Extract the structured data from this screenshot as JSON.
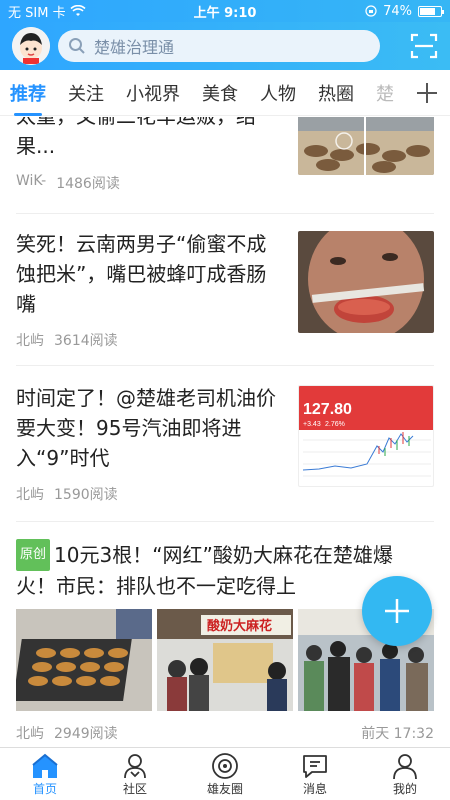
{
  "statusbar": {
    "carrier": "无 SIM 卡",
    "time": "上午 9:10",
    "battery": "74%",
    "battery_level": 0.74
  },
  "header": {
    "search_placeholder": "楚雄治理通"
  },
  "tabs": [
    "推荐",
    "关注",
    "小视界",
    "美食",
    "人物",
    "热圈",
    "楚"
  ],
  "articles": [
    {
      "title": "太重，又偷二花车运贩，结果...",
      "author": "WiK-",
      "reads": "1486阅读"
    },
    {
      "title": "笑死！云南两男子“偷蜜不成蚀把米”，嘴巴被蜂叮成香肠嘴",
      "author": "北屿",
      "reads": "3614阅读"
    },
    {
      "title": "时间定了！@楚雄老司机油价要大变！95号汽油即将进入“9”时代",
      "author": "北屿",
      "reads": "1590阅读",
      "chart_price": "127.80",
      "chart_change": "+3.43",
      "chart_pct": "2.76%"
    },
    {
      "tag": "原创",
      "title": "10元3根！“网红”酸奶大麻花在楚雄爆火！市民：排队也不一定吃得上",
      "author": "北屿",
      "reads": "2949阅读",
      "time": "前天 17:32",
      "shop_sign": "酸奶大麻花"
    }
  ],
  "bottom_nav": [
    "首页",
    "社区",
    "雄友圈",
    "消息",
    "我的"
  ]
}
